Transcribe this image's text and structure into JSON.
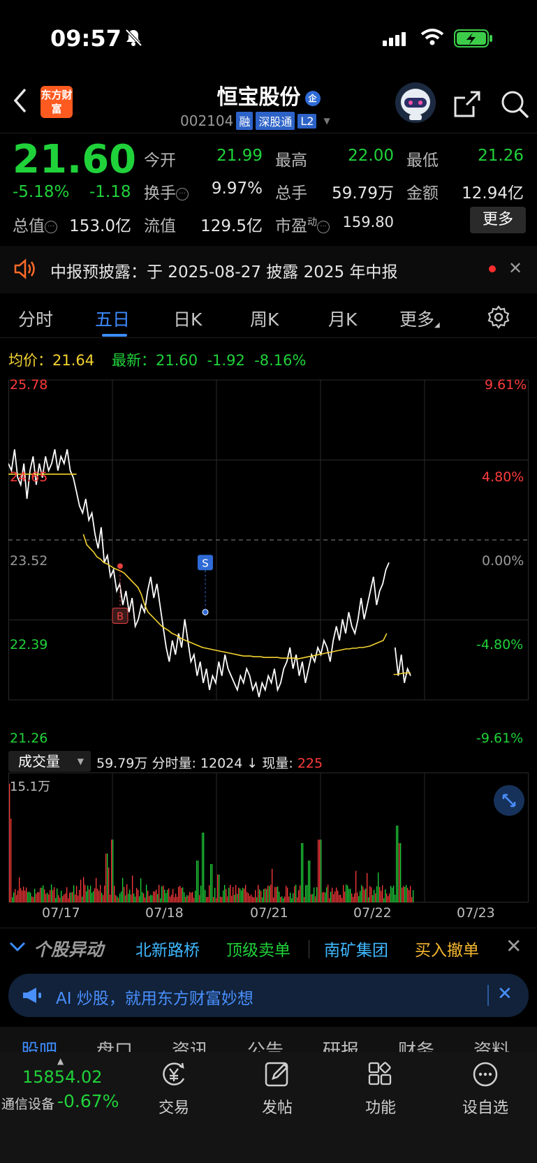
{
  "status_bar": {
    "time": "09:57"
  },
  "header": {
    "logo_text": "东方财富",
    "stock_name": "恒宝股份",
    "enterprise_badge": "企",
    "stock_code": "002104",
    "tags": [
      "融",
      "深股通",
      "L2"
    ]
  },
  "quote": {
    "price": "21.60",
    "pct_change": "-5.18%",
    "abs_change": "-1.18",
    "open_label": "今开",
    "open": "21.99",
    "high_label": "最高",
    "high": "22.00",
    "low_label": "最低",
    "low": "21.26",
    "turnover_label": "换手",
    "turnover": "9.97%",
    "volume_label": "总手",
    "volume": "59.79万",
    "amount_label": "金额",
    "amount": "12.94亿",
    "mktcap_label": "总值",
    "mktcap": "153.0亿",
    "float_label": "流值",
    "float": "129.5亿",
    "pe_label": "市盈",
    "pe_sup": "动",
    "pe": "159.80",
    "more_label": "更多"
  },
  "notice": {
    "text": "中报预披露：于 2025-08-27 披露 2025 年中报"
  },
  "chart_tabs": [
    "分时",
    "五日",
    "日K",
    "周K",
    "月K",
    "更多"
  ],
  "legend": {
    "avg_label": "均价：",
    "avg_value": "21.64",
    "latest_label": "最新：",
    "latest_value": "21.60",
    "latest_change": "-1.92",
    "latest_pct": "-8.16%"
  },
  "volume_panel": {
    "selector": "成交量",
    "total": "59.79万",
    "tick_label": "分时量:",
    "tick_value": "12024",
    "arrow": "↓",
    "now_label": "现量:",
    "now_value": "225",
    "max_label": "15.1万"
  },
  "chart_data": {
    "type": "line",
    "x_labels": [
      "07/17",
      "07/18",
      "07/21",
      "07/22",
      "07/23"
    ],
    "y_left_ticks": [
      "25.78",
      "24.65",
      "23.52",
      "22.39",
      "21.26"
    ],
    "y_right_ticks": [
      "9.61%",
      "4.80%",
      "0.00%",
      "-4.80%",
      "-9.61%"
    ],
    "ylim": [
      21.26,
      25.78
    ],
    "baseline": 23.52,
    "series": [
      {
        "name": "price",
        "color": "#ffffff",
        "values": [
          24.6,
          24.5,
          24.8,
          24.4,
          24.3,
          24.6,
          24.1,
          24.5,
          24.7,
          24.3,
          24.6,
          24.4,
          24.7,
          24.5,
          24.6,
          24.8,
          24.5,
          24.7,
          24.6,
          24.8,
          24.5,
          24.4,
          24.2,
          24.0,
          23.9,
          24.1,
          23.8,
          23.9,
          23.6,
          23.4,
          23.7,
          23.2,
          23.3,
          23.0,
          23.1,
          22.8,
          22.9,
          22.6,
          22.8,
          22.5,
          22.7,
          22.3,
          22.4,
          22.6,
          22.5,
          22.8,
          23.0,
          22.7,
          22.9,
          22.6,
          22.3,
          22.0,
          21.8,
          22.1,
          21.9,
          22.2,
          22.0,
          22.4,
          22.1,
          21.8,
          21.9,
          21.6,
          21.8,
          21.5,
          21.7,
          21.4,
          21.6,
          21.5,
          21.8,
          21.6,
          21.9,
          21.7,
          21.6,
          21.5,
          21.4,
          21.6,
          21.5,
          21.7,
          21.6,
          21.4,
          21.5,
          21.3,
          21.5,
          21.4,
          21.6,
          21.5,
          21.7,
          21.4,
          21.5,
          21.7,
          21.8,
          22.0,
          21.7,
          21.9,
          21.6,
          21.8,
          21.5,
          21.7,
          21.9,
          21.8,
          22.0,
          21.9,
          22.1,
          22.0,
          21.8,
          22.1,
          22.3,
          22.1,
          22.4,
          22.2,
          22.5,
          22.3,
          22.2,
          22.4,
          22.7,
          22.4,
          22.6,
          22.8,
          23.0,
          22.6,
          22.8,
          22.9,
          23.1,
          23.2,
          null,
          22.0,
          21.6,
          21.9,
          21.5,
          21.7,
          21.6
        ]
      },
      {
        "name": "avg",
        "color": "#f5d431",
        "values": [
          24.45,
          24.45,
          24.45,
          24.45,
          24.45,
          24.45,
          24.45,
          24.45,
          24.45,
          24.45,
          24.45,
          24.45,
          24.45,
          24.45,
          24.45,
          24.45,
          24.45,
          24.45,
          24.45,
          24.45,
          24.45,
          null,
          23.6,
          23.45,
          23.4,
          23.35,
          23.28,
          23.25,
          23.2,
          23.18,
          23.15,
          23.12,
          23.1,
          23.08,
          23.05,
          23.0,
          22.95,
          22.9,
          22.85,
          22.75,
          22.6,
          22.5,
          22.45,
          22.4,
          22.35,
          22.3,
          22.27,
          22.24,
          22.2,
          22.18,
          22.15,
          22.12,
          22.1,
          22.08,
          22.06,
          22.04,
          22.02,
          22.0,
          21.99,
          21.98,
          21.97,
          21.96,
          21.95,
          21.94,
          21.93,
          21.92,
          21.91,
          21.9,
          21.89,
          21.88,
          21.88,
          21.88,
          21.87,
          21.87,
          21.87,
          21.86,
          21.86,
          21.86,
          21.86,
          21.86,
          21.85,
          21.85,
          21.85,
          21.85,
          21.85,
          21.84,
          21.85,
          21.86,
          21.87,
          21.88,
          21.89,
          21.9,
          21.91,
          21.92,
          21.93,
          21.94,
          21.95,
          21.96,
          21.97,
          21.98,
          21.98,
          21.99,
          21.99,
          22.0,
          22.0,
          22.01,
          22.02,
          22.04,
          22.06,
          22.08,
          22.1,
          22.2,
          null,
          21.62,
          21.62,
          21.63,
          21.64,
          21.64,
          21.64
        ]
      }
    ],
    "trade_markers": [
      {
        "label": "B",
        "price": 23.15,
        "color": "#e94040"
      },
      {
        "label": "S",
        "price": 22.5,
        "color": "#2f6bd6"
      }
    ]
  },
  "movers": {
    "title": "个股异动",
    "items": [
      {
        "text": "北新路桥",
        "color": "#3fb8ff"
      },
      {
        "text": "顶级卖单",
        "color": "#20d23a"
      },
      {
        "text": "南矿集团",
        "color": "#3fb8ff"
      },
      {
        "text": "买入撤单",
        "color": "#f5b731"
      }
    ]
  },
  "ai_banner": {
    "text": "AI 炒股，就用东方财富妙想"
  },
  "sub_tabs": [
    "股吧",
    "盘口",
    "资讯",
    "公告",
    "研报",
    "财务",
    "资料"
  ],
  "bottom_nav": {
    "index_value": "15854.02",
    "index_name": "通信设备",
    "index_change": "-0.67%",
    "items": [
      "交易",
      "发帖",
      "功能",
      "设自选"
    ]
  }
}
